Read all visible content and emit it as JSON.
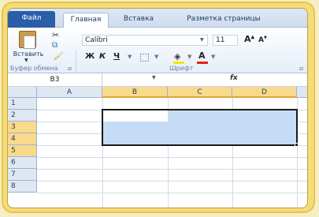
{
  "tabs": {
    "file": "Файл",
    "home": "Главная",
    "insert": "Вставка",
    "layout": "Разметка страницы"
  },
  "ribbon": {
    "paste_label": "Вставить",
    "font_name": "Calibri",
    "font_size": "11",
    "grow_font": "A",
    "shrink_font": "A",
    "bold": "Ж",
    "italic": "К",
    "underline": "Ч",
    "font_color": "A",
    "clipboard_group": "Буфер обмена",
    "font_group": "Шрифт",
    "fill_color": "#f4e500",
    "text_color": "#e2241c"
  },
  "formula_bar": {
    "name_box": "B3",
    "fx": "fx"
  },
  "sheet": {
    "columns": [
      "A",
      "B",
      "C",
      "D"
    ],
    "rows": [
      "1",
      "2",
      "3",
      "4",
      "5",
      "6",
      "7",
      "8"
    ],
    "selected_columns": [
      "B",
      "C",
      "D"
    ],
    "selected_rows": [
      "3",
      "4",
      "5"
    ],
    "selection_color": "#c5dcf6"
  }
}
